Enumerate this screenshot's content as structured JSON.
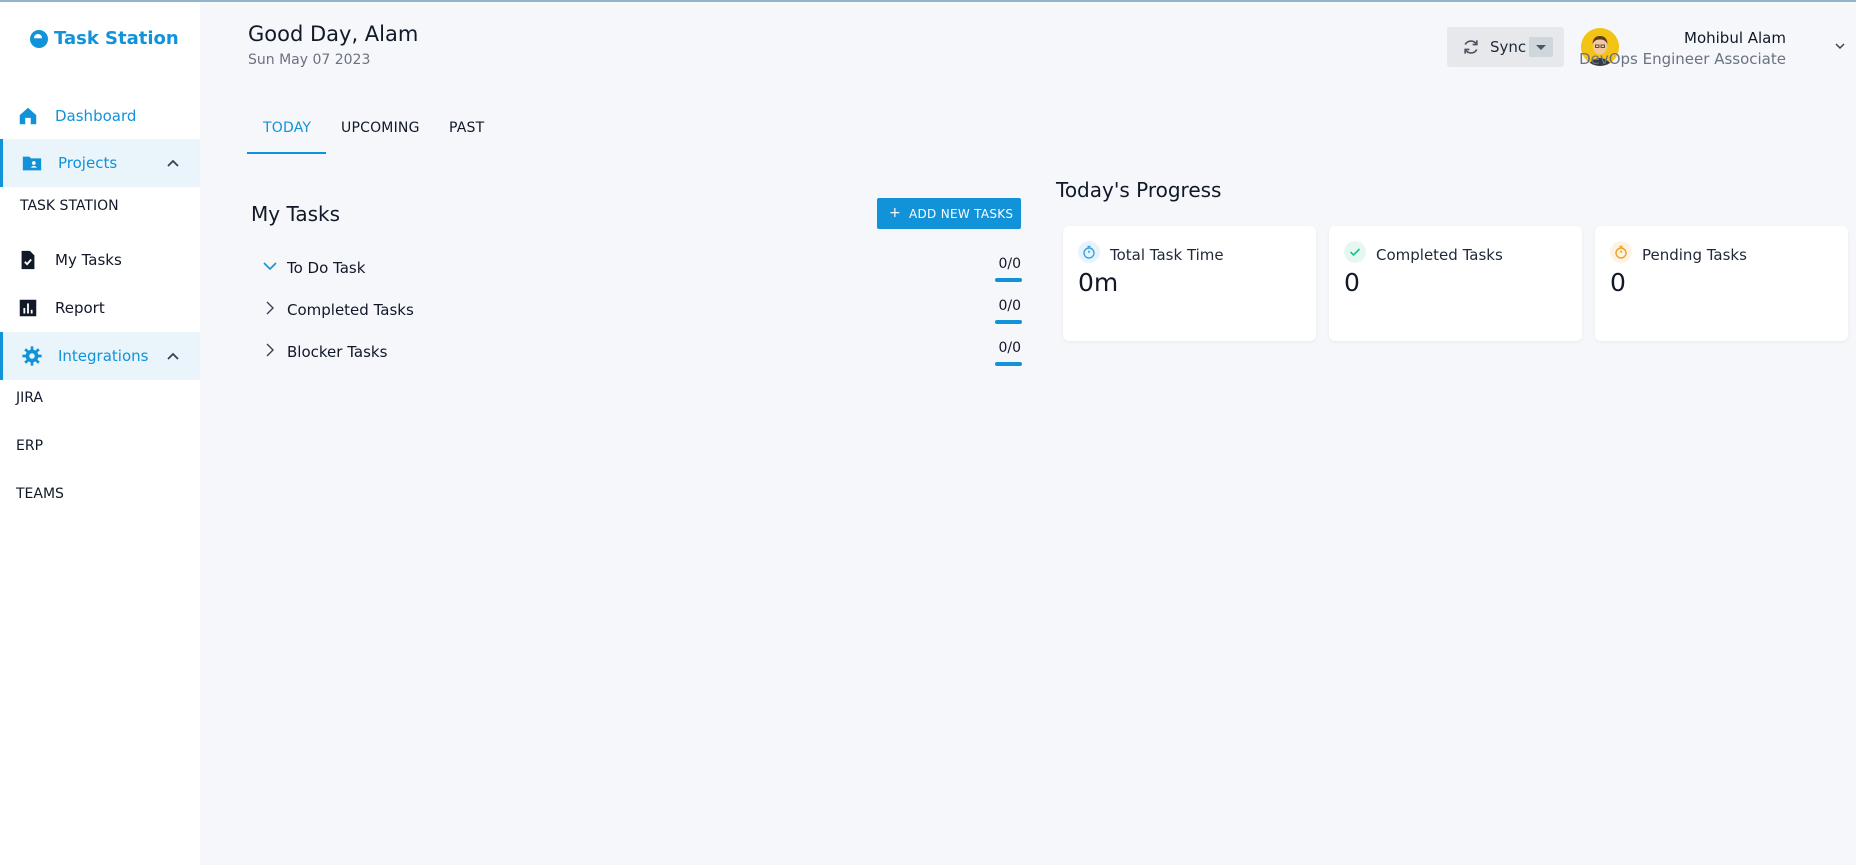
{
  "brand": {
    "name": "Task Station"
  },
  "sidebar": {
    "items": [
      {
        "label": "Dashboard"
      },
      {
        "label": "Projects"
      },
      {
        "label": "My Tasks"
      },
      {
        "label": "Report"
      },
      {
        "label": "Integrations"
      }
    ],
    "projects": [
      "TASK STATION"
    ],
    "integrations": [
      "JIRA",
      "ERP",
      "TEAMS"
    ]
  },
  "header": {
    "greeting": "Good Day, Alam",
    "date": "Sun May 07 2023",
    "sync_label": "Sync",
    "user_name": "Mohibul Alam",
    "user_role": "DevOps Engineer Associate"
  },
  "tabs": [
    {
      "label": "TODAY",
      "active": true
    },
    {
      "label": "UPCOMING",
      "active": false
    },
    {
      "label": "PAST",
      "active": false
    }
  ],
  "my_tasks": {
    "title": "My Tasks",
    "add_label": "ADD NEW TASKS",
    "groups": [
      {
        "label": "To Do Task",
        "count": "0/0",
        "expanded": true
      },
      {
        "label": "Completed Tasks",
        "count": "0/0",
        "expanded": false
      },
      {
        "label": "Blocker Tasks",
        "count": "0/0",
        "expanded": false
      }
    ]
  },
  "progress": {
    "title": "Today's Progress",
    "cards": [
      {
        "label": "Total Task Time",
        "value": "0m",
        "icon": "stopwatch-icon",
        "color": "#3aa1e0"
      },
      {
        "label": "Completed Tasks",
        "value": "0",
        "icon": "check-icon",
        "color": "#1fbf8f"
      },
      {
        "label": "Pending Tasks",
        "value": "0",
        "icon": "timer-icon",
        "color": "#f0a020"
      }
    ]
  },
  "colors": {
    "accent": "#1192d9",
    "background": "#f5f7fb"
  }
}
